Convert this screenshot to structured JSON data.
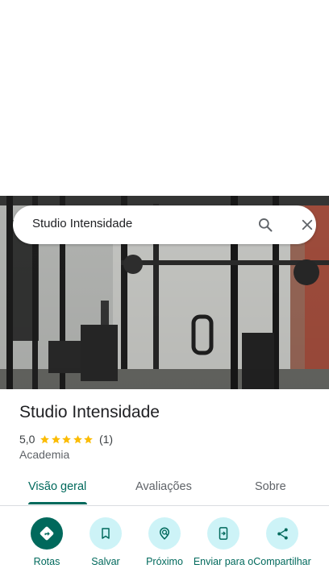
{
  "search": {
    "query": "Studio Intensidade"
  },
  "icons": {
    "search": "search-icon",
    "close": "close-icon",
    "star": "star-icon",
    "directions": "directions-icon",
    "save": "bookmark-icon",
    "nearby": "nearby-icon",
    "send": "send-to-phone-icon",
    "share": "share-icon"
  },
  "place": {
    "title": "Studio Intensidade",
    "rating": "5,0",
    "stars": 5,
    "review_count": "(1)",
    "category": "Academia"
  },
  "tabs": [
    {
      "label": "Visão geral",
      "active": true
    },
    {
      "label": "Avaliações",
      "active": false
    },
    {
      "label": "Sobre",
      "active": false
    }
  ],
  "actions": [
    {
      "label": "Rotas"
    },
    {
      "label": "Salvar"
    },
    {
      "label": "Próximo"
    },
    {
      "label": "Enviar para o"
    },
    {
      "label": "Compartilhar"
    }
  ],
  "colors": {
    "accent": "#00695c",
    "action_bg": "#cdf3f7",
    "star": "#fbbc04",
    "text_primary": "#202124",
    "text_secondary": "#5f6368"
  }
}
